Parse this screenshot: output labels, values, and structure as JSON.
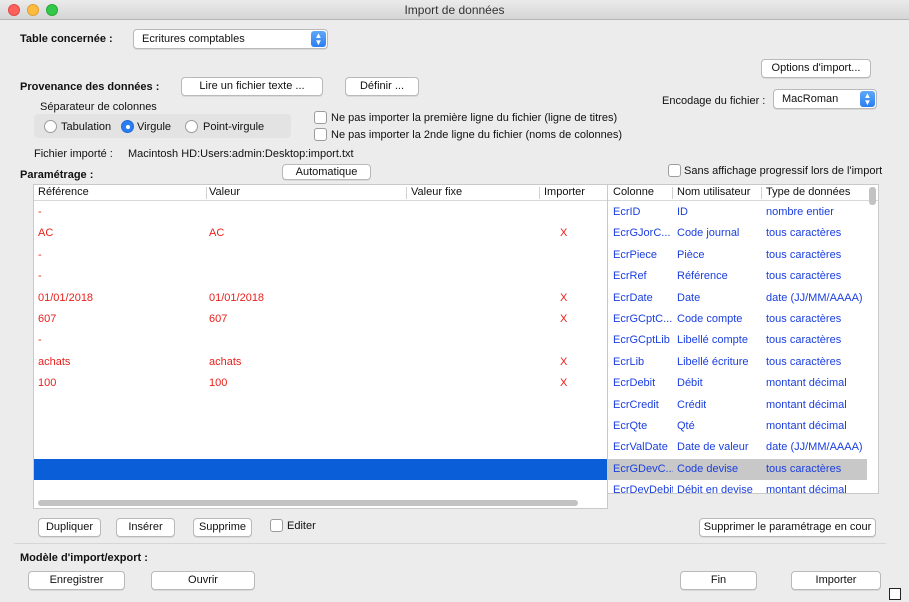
{
  "window": {
    "title": "Import de données"
  },
  "table_label": "Table concernée :",
  "table_select": "Ecritures comptables",
  "provenance_label": "Provenance des données :",
  "read_text_button": "Lire un fichier texte ...",
  "define_button": "Définir ...",
  "import_options_button": "Options d'import...",
  "encoding_label": "Encodage du fichier :",
  "encoding_select": "MacRoman",
  "separator_label": "Séparateur de colonnes",
  "separator_options": [
    {
      "label": "Tabulation",
      "selected": false
    },
    {
      "label": "Virgule",
      "selected": true
    },
    {
      "label": "Point-virgule",
      "selected": false
    }
  ],
  "skip_first_line": "Ne pas importer la première ligne du fichier (ligne de titres)",
  "skip_second_line": "Ne pas importer la 2nde ligne du fichier (noms de colonnes)",
  "imported_file_label": "Fichier importé :",
  "imported_file_path": "Macintosh HD:Users:admin:Desktop:import.txt",
  "parametrage_label": "Paramétrage :",
  "automatique_button": "Automatique",
  "no_progress_display": "Sans affichage progressif lors de l'import",
  "left_table": {
    "headers": [
      "Référence",
      "Valeur",
      "Valeur fixe",
      "Importer"
    ],
    "rows": [
      {
        "ref": "-",
        "val": "",
        "fixed": "",
        "imp": ""
      },
      {
        "ref": "AC",
        "val": "AC",
        "fixed": "",
        "imp": "X"
      },
      {
        "ref": "-",
        "val": "",
        "fixed": "",
        "imp": ""
      },
      {
        "ref": "-",
        "val": "",
        "fixed": "",
        "imp": ""
      },
      {
        "ref": "01/01/2018",
        "val": "01/01/2018",
        "fixed": "",
        "imp": "X"
      },
      {
        "ref": "607",
        "val": "607",
        "fixed": "",
        "imp": "X"
      },
      {
        "ref": "-",
        "val": "",
        "fixed": "",
        "imp": ""
      },
      {
        "ref": "achats",
        "val": "achats",
        "fixed": "",
        "imp": "X"
      },
      {
        "ref": "100",
        "val": "100",
        "fixed": "",
        "imp": "X"
      },
      {
        "ref": "",
        "val": "",
        "fixed": "",
        "imp": ""
      },
      {
        "ref": "",
        "val": "",
        "fixed": "",
        "imp": ""
      },
      {
        "ref": "",
        "val": "",
        "fixed": "",
        "imp": ""
      },
      {
        "ref": "",
        "val": "",
        "fixed": "",
        "imp": ""
      },
      {
        "ref": "",
        "val": "",
        "fixed": "",
        "imp": ""
      }
    ]
  },
  "right_table": {
    "headers": [
      "Colonne",
      "Nom utilisateur",
      "Type de données"
    ],
    "rows": [
      {
        "col": "EcrID",
        "name": "ID",
        "type": "nombre entier"
      },
      {
        "col": "EcrGJorC...",
        "name": "Code journal",
        "type": "tous caractères"
      },
      {
        "col": "EcrPiece",
        "name": "Pièce",
        "type": "tous caractères"
      },
      {
        "col": "EcrRef",
        "name": "Référence",
        "type": "tous caractères"
      },
      {
        "col": "EcrDate",
        "name": "Date",
        "type": "date (JJ/MM/AAAA)"
      },
      {
        "col": "EcrGCptC...",
        "name": "Code compte",
        "type": "tous caractères"
      },
      {
        "col": "EcrGCptLib",
        "name": "Libellé compte",
        "type": "tous caractères"
      },
      {
        "col": "EcrLib",
        "name": "Libellé écriture",
        "type": "tous caractères"
      },
      {
        "col": "EcrDebit",
        "name": "Débit",
        "type": "montant décimal"
      },
      {
        "col": "EcrCredit",
        "name": "Crédit",
        "type": "montant décimal"
      },
      {
        "col": "EcrQte",
        "name": "Qté",
        "type": "montant décimal"
      },
      {
        "col": "EcrValDate",
        "name": "Date de valeur",
        "type": "date (JJ/MM/AAAA)"
      },
      {
        "col": "EcrGDevC...",
        "name": "Code devise",
        "type": "tous caractères"
      },
      {
        "col": "EcrDevDebit",
        "name": "Débit en devise",
        "type": "montant décimal"
      }
    ]
  },
  "dupliquer_button": "Dupliquer",
  "inserer_button": "Insérer",
  "supprimer_button": "Supprime",
  "editer_label": "Editer",
  "supprimer_param_button": "Supprimer le paramétrage en cour",
  "modele_label": "Modèle d'import/export :",
  "enregistrer_button": "Enregistrer",
  "ouvrir_button": "Ouvrir",
  "fin_button": "Fin",
  "importer_button": "Importer",
  "colors": {
    "red_text": "#e8201c",
    "blue_text": "#1a3ee0",
    "selection": "#0a5ed7",
    "accent": "#2a7ef2"
  }
}
